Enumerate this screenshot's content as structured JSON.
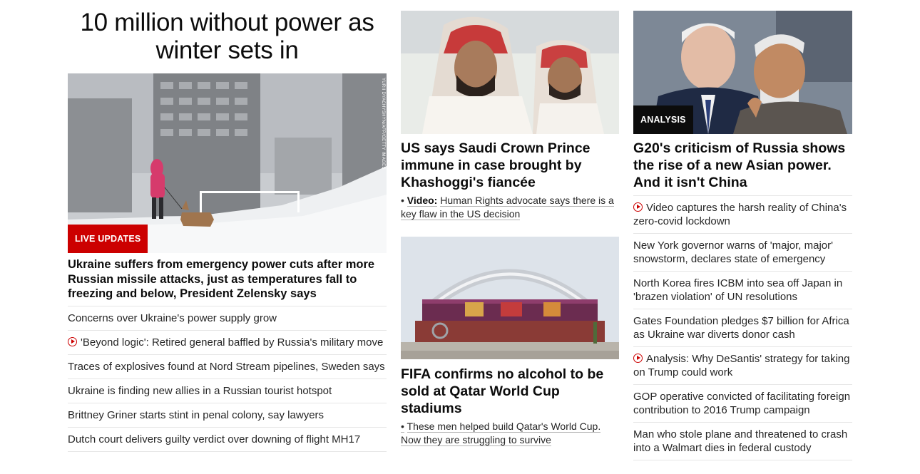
{
  "left": {
    "title": "10 million without power as winter sets in",
    "image_credit": "YURII DYACHYSHYN/AFP/GETTY IMAGES",
    "badge": "LIVE UPDATES",
    "headline": "Ukraine suffers from emergency power cuts after more Russian missile attacks, just as temperatures fall to freezing and below, President Zelensky says",
    "items": [
      {
        "text": "Concerns over Ukraine's power supply grow",
        "video": false
      },
      {
        "text": "'Beyond logic': Retired general baffled by Russia's military move",
        "video": true
      },
      {
        "text": "Traces of explosives found at Nord Stream pipelines, Sweden says",
        "video": false
      },
      {
        "text": "Ukraine is finding new allies in a Russian tourist hotspot",
        "video": false
      },
      {
        "text": "Brittney Griner starts stint in penal colony, say lawyers",
        "video": false
      },
      {
        "text": "Dutch court delivers guilty verdict over downing of flight MH17",
        "video": false
      }
    ]
  },
  "middle": {
    "story1": {
      "headline": "US says Saudi Crown Prince immune in case brought by Khashoggi's fiancée",
      "sub_bullet": "•",
      "sub_label": "Video:",
      "sub_text": "Human Rights advocate says there is a key flaw in the US decision"
    },
    "story2": {
      "headline": "FIFA confirms no alcohol to be sold at Qatar World Cup stadiums",
      "sub_bullet": "•",
      "sub_text": "These men helped build Qatar's World Cup. Now they are struggling to survive"
    }
  },
  "right": {
    "badge": "ANALYSIS",
    "headline": "G20's criticism of Russia shows the rise of a new Asian power. And it isn't China",
    "items": [
      {
        "text": "Video captures the harsh reality of China's zero-covid lockdown",
        "video": true
      },
      {
        "text": "New York governor warns of 'major, major' snowstorm, declares state of emergency",
        "video": false
      },
      {
        "text": "North Korea fires ICBM into sea off Japan in 'brazen violation' of UN resolutions",
        "video": false
      },
      {
        "text": "Gates Foundation pledges $7 billion for Africa as Ukraine war diverts donor cash",
        "video": false
      },
      {
        "text": "Analysis: Why DeSantis' strategy for taking on Trump could work",
        "video": true
      },
      {
        "text": "GOP operative convicted of facilitating foreign contribution to 2016 Trump campaign",
        "video": false
      },
      {
        "text": "Man who stole plane and threatened to crash into a Walmart dies in federal custody",
        "video": false
      }
    ]
  },
  "colors": {
    "accent_red": "#cc0000",
    "text": "#0c0c0c",
    "body_text": "#262626",
    "divider": "#e6e6e6"
  }
}
